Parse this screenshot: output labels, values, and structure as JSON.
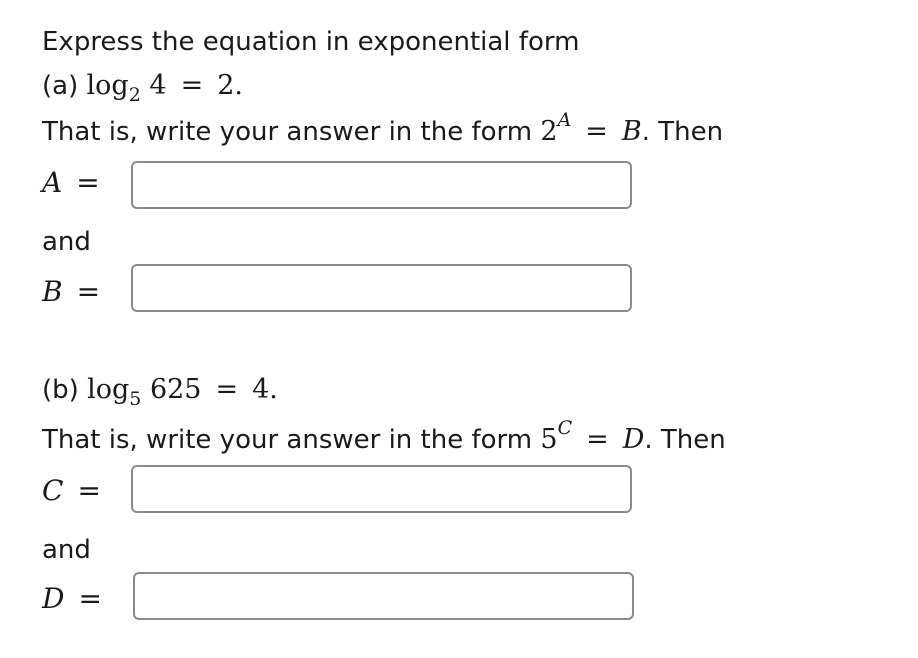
{
  "heading": "Express the equation in exponential form",
  "part_a": {
    "prefix": "(a)",
    "log": "log",
    "base": "2",
    "argument": "4",
    "equals": "=",
    "result": "2.",
    "instruction_text": "That is, write your answer in the form",
    "form_base": "2",
    "form_exponent": "A",
    "form_rhs": "B",
    "then_text": ". Then",
    "label_1": "A",
    "label_2": "B",
    "and_text": "and",
    "input_1_value": "",
    "input_2_value": ""
  },
  "part_b": {
    "prefix": "(b)",
    "log": "log",
    "base": "5",
    "argument": "625",
    "equals": "=",
    "result": "4.",
    "instruction_text": "That is, write your answer in the form",
    "form_base": "5",
    "form_exponent": "C",
    "form_rhs": "D",
    "then_text": ". Then",
    "label_1": "C",
    "label_2": "D",
    "and_text": "and",
    "input_1_value": "",
    "input_2_value": ""
  },
  "equals_sign": "="
}
